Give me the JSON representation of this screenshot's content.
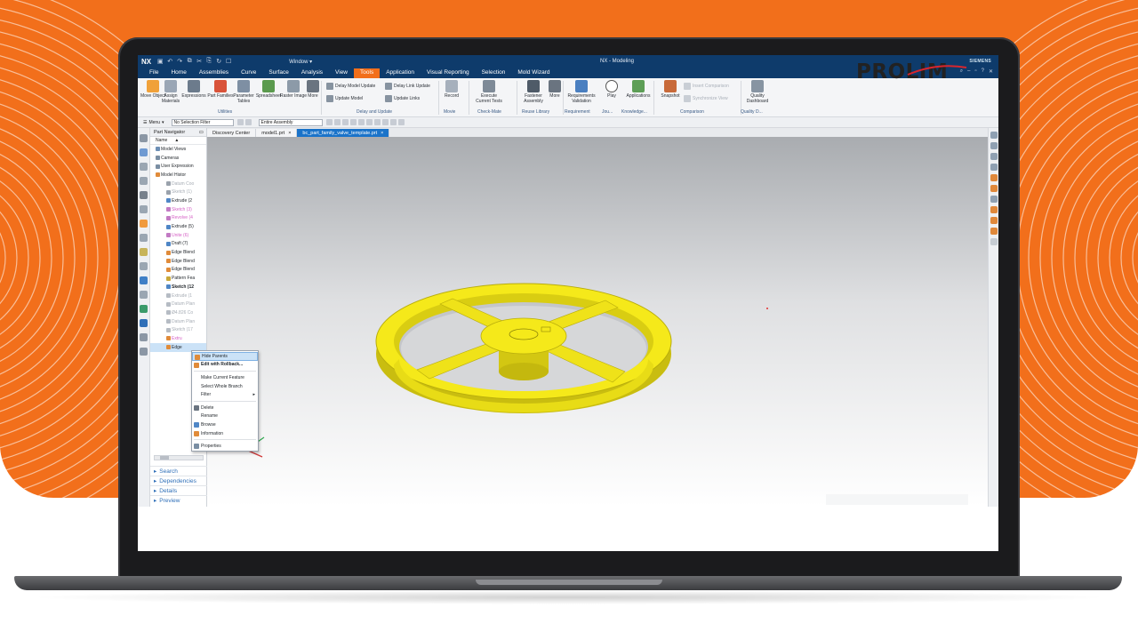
{
  "app": {
    "logo": "NX",
    "window_menu": "Window ▾",
    "title": "NX - Modeling",
    "vendor": "SIEMENS"
  },
  "brand": {
    "logo_text": "PROLIM"
  },
  "ribbon_tabs": [
    "File",
    "Home",
    "Assemblies",
    "Curve",
    "Surface",
    "Analysis",
    "View",
    "Tools",
    "Application",
    "Visual Reporting",
    "Selection",
    "Mold Wizard"
  ],
  "active_tab": "Tools",
  "ribbon": {
    "move_object": "Move Object",
    "assign_materials": "Assign Materials",
    "expressions": "Expressions",
    "part_families": "Part Families",
    "parameter_tables": "Parameter Tables",
    "spreadsheet": "Spreadsheet",
    "raster_image": "Raster Image",
    "more1": "More",
    "delay_model_update": "Delay Model Update",
    "update_model": "Update Model",
    "delay_link_update": "Delay Link Update",
    "update_links": "Update Links",
    "record": "Record",
    "execute_current_tests": "Execute Current Tests",
    "fastener_assembly": "Fastener Assembly",
    "more2": "More",
    "requirements_validation": "Requirements Validation",
    "play": "Play",
    "applications": "Applications",
    "snapshot": "Snapshot",
    "insert_comparison": "Insert Comparison",
    "synchronize_view": "Synchronize View",
    "quality_dashboard": "Quality Dashboard",
    "groups": [
      "Utilities",
      "Delay and Update",
      "Movie",
      "Check-Mate",
      "Reuse Library",
      "Requirement",
      "Jou...",
      "Knowledge...",
      "Comparison",
      "Quality D..."
    ]
  },
  "filterbar": {
    "menu": "Menu",
    "selection_filter": "No Selection Filter",
    "scope": "Entire Assembly"
  },
  "navigator": {
    "title": "Part Navigator",
    "column": "Name",
    "nodes": [
      {
        "label": "Model Views",
        "style": ""
      },
      {
        "label": "Cameras",
        "style": ""
      },
      {
        "label": "User Expression",
        "style": ""
      },
      {
        "label": "Model Histor",
        "style": ""
      },
      {
        "label": "Datum Coo",
        "style": "dim"
      },
      {
        "label": "Sketch (1)",
        "style": "dim"
      },
      {
        "label": "Extrude (2",
        "style": ""
      },
      {
        "label": "Sketch (3)",
        "style": "pink"
      },
      {
        "label": "Revolve (4",
        "style": "pink"
      },
      {
        "label": "Extrude (5)",
        "style": ""
      },
      {
        "label": "Unite (6)",
        "style": "pink"
      },
      {
        "label": "Draft (7)",
        "style": ""
      },
      {
        "label": "Edge Blend",
        "style": ""
      },
      {
        "label": "Edge Blend",
        "style": ""
      },
      {
        "label": "Edge Blend",
        "style": ""
      },
      {
        "label": "Pattern Fea",
        "style": ""
      },
      {
        "label": "Sketch (12",
        "style": "bold"
      },
      {
        "label": "Extrude (1",
        "style": "dim"
      },
      {
        "label": "Datum Plan",
        "style": "dim"
      },
      {
        "label": "Ø4.826 Co",
        "style": "dim"
      },
      {
        "label": "Datum Plan",
        "style": "dim"
      },
      {
        "label": "Sketch (17",
        "style": "dim"
      },
      {
        "label": "Extru",
        "style": "pink"
      },
      {
        "label": "Edge",
        "style": "hl"
      }
    ],
    "panels": [
      "Search",
      "Dependencies",
      "Details",
      "Preview"
    ]
  },
  "graphics_tabs": [
    "Discovery Center",
    "model1.prt",
    "bc_part_family_valve_template.prt"
  ],
  "active_graphics_tab": "bc_part_family_valve_template.prt",
  "context_menu": {
    "items": [
      {
        "label": "Hide Parents",
        "style": "active",
        "icon": "hide-parents-icon"
      },
      {
        "label": "Edit with Rollback...",
        "style": "bold",
        "icon": "edit-rollback-icon"
      },
      {
        "sep": true
      },
      {
        "label": "Make Current Feature",
        "style": "",
        "icon": ""
      },
      {
        "label": "Select Whole Branch",
        "style": "",
        "icon": ""
      },
      {
        "label": "Filter",
        "style": "",
        "icon": "",
        "submenu": true
      },
      {
        "sep": true
      },
      {
        "label": "Delete",
        "style": "",
        "icon": "delete-icon"
      },
      {
        "label": "Rename",
        "style": "",
        "icon": ""
      },
      {
        "label": "Browse",
        "style": "",
        "icon": "browse-icon"
      },
      {
        "label": "Information",
        "style": "",
        "icon": "information-icon"
      },
      {
        "sep": true
      },
      {
        "label": "Properties",
        "style": "",
        "icon": "properties-icon"
      }
    ]
  },
  "colors": {
    "brand_orange": "#f26f1b",
    "nx_blue": "#0e3b6b",
    "model_yellow": "#f5e91a",
    "highlight": "#cbe2f7"
  }
}
